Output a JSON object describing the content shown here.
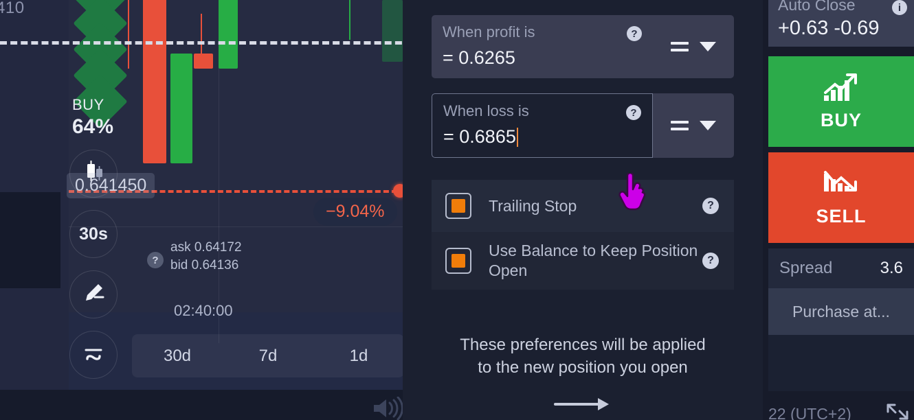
{
  "chart": {
    "axis_label_top": "410",
    "buy_word": "BUY",
    "buy_percent": "64%",
    "price_tag": "0.641450",
    "timer": "30s",
    "percent_badge": "−9.04%",
    "ask_line": "ask 0.64172",
    "bid_line": "bid 0.64136",
    "help_glyph": "?",
    "time_label": "02:40:00",
    "timeframes": [
      {
        "label": "30d"
      },
      {
        "label": "7d"
      },
      {
        "label": "1d"
      }
    ],
    "tools": [
      {
        "name": "candlestick-chart-type-icon"
      },
      {
        "name": "timeframe-30s"
      },
      {
        "name": "draw-pencil-icon"
      },
      {
        "name": "undo-icon"
      }
    ],
    "speaker_icon": "volume-icon",
    "candle_up_color": "#27ad45",
    "candle_down_color": "#e8503a",
    "dashed_price_line_color": "#d8dbe6",
    "entry_line_color": "#e8503a"
  },
  "dialog": {
    "profit_field": {
      "label": "When profit is",
      "value": "= 0.6265",
      "help_glyph": "?",
      "operator": "=",
      "operator_icon": "equals-icon",
      "chevron_icon": "chevron-down-icon"
    },
    "loss_field": {
      "label": "When loss is",
      "value": "= 0.6865",
      "help_glyph": "?",
      "operator": "=",
      "operator_icon": "equals-icon",
      "chevron_icon": "chevron-down-icon",
      "focused": true,
      "caret_color": "#f08a3c"
    },
    "options": [
      {
        "label": "Trailing Stop",
        "checked": true,
        "help_glyph": "?",
        "check_color": "#f07d0a"
      },
      {
        "label": "Use Balance to Keep Position Open",
        "checked": true,
        "help_glyph": "?",
        "check_color": "#f07d0a"
      }
    ],
    "note_line1": "These preferences will be applied",
    "note_line2": "to the new position you open",
    "next_arrow_icon": "arrow-right-icon",
    "cursor_icon": "pointer-hand-cursor"
  },
  "right_panel": {
    "auto_close_title": "Auto Close",
    "auto_close_info_glyph": "i",
    "auto_close_values": "+0.63 -0.69",
    "buy_button": {
      "label": "BUY",
      "icon": "trend-up-icon",
      "color": "#2cab4a"
    },
    "sell_button": {
      "label": "SELL",
      "icon": "trend-down-icon",
      "color": "#e2472c"
    },
    "spread_label": "Spread",
    "spread_value": "3.6",
    "purchase_label": "Purchase at...",
    "utc_label": "22 (UTC+2)",
    "expand_icon": "fullscreen-icon"
  }
}
